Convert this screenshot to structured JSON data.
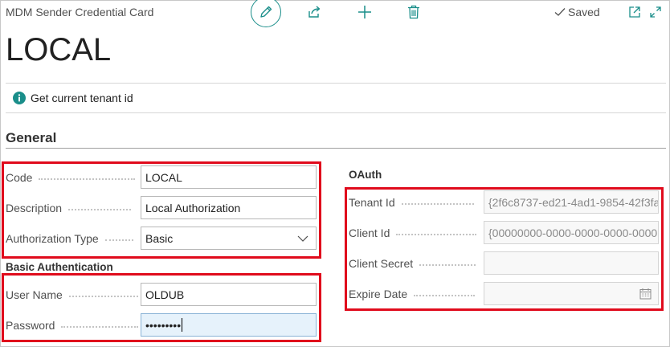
{
  "header": {
    "caption": "MDM Sender Credential Card",
    "saved_label": "Saved",
    "title": "LOCAL"
  },
  "actions": {
    "get_tenant_label": "Get current tenant id"
  },
  "general": {
    "title": "General",
    "code": {
      "label": "Code",
      "value": "LOCAL"
    },
    "description": {
      "label": "Description",
      "value": "Local Authorization"
    },
    "auth_type": {
      "label": "Authorization Type",
      "value": "Basic"
    }
  },
  "basic_auth": {
    "title": "Basic Authentication",
    "user_name": {
      "label": "User Name",
      "value": "OLDUB"
    },
    "password": {
      "label": "Password",
      "value": "•••••••••"
    }
  },
  "oauth": {
    "title": "OAuth",
    "tenant_id": {
      "label": "Tenant Id",
      "value": "{2f6c8737-ed21-4ad1-9854-42f3fa"
    },
    "client_id": {
      "label": "Client Id",
      "value": "{00000000-0000-0000-0000-0000"
    },
    "client_secret": {
      "label": "Client Secret",
      "value": ""
    },
    "expire_date": {
      "label": "Expire Date",
      "value": ""
    }
  },
  "colors": {
    "accent": "#1a8e8a",
    "highlight": "#e00b1c",
    "focus_bg": "#e6f2fb"
  },
  "icons": [
    "edit-icon",
    "share-icon",
    "plus-icon",
    "trash-icon",
    "check-icon",
    "open-new-window-icon",
    "expand-icon",
    "info-icon",
    "chevron-down-icon",
    "calendar-icon"
  ]
}
